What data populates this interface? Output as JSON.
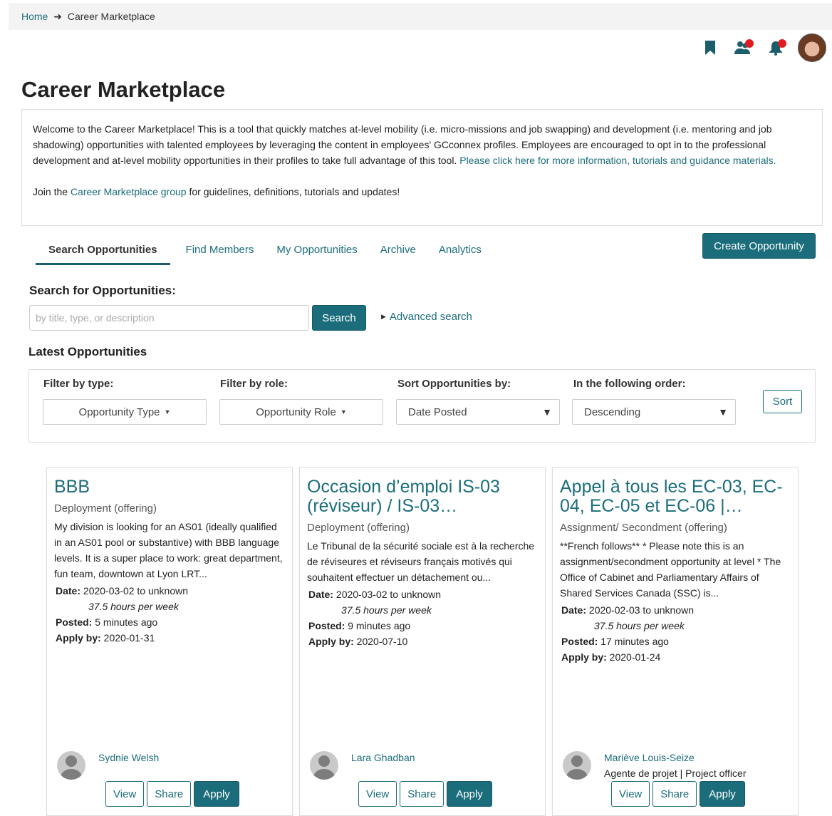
{
  "breadcrumb": {
    "home": "Home",
    "separator": "➜",
    "current": "Career Marketplace"
  },
  "header_icons": [
    "bookmark-icon",
    "colleagues-icon",
    "notifications-icon",
    "user-avatar"
  ],
  "page_title": "Career Marketplace",
  "welcome": {
    "text": "Welcome to the Career Marketplace! This is a tool that quickly matches at-level mobility (i.e. micro-missions and job swapping) and development (i.e. mentoring and job shadowing) opportunities with talented employees by leveraging the content in employees' GCconnex profiles. Employees are encouraged to opt in to the professional development and at-level mobility opportunities in their profiles to take full advantage of this tool.",
    "more_info_link": "Please click here for more information, tutorials and guidance materials.",
    "join_prefix": "Join the",
    "group_link": "Career Marketplace group",
    "join_suffix": "for guidelines, definitions, tutorials and updates!"
  },
  "tabs": [
    {
      "label": "Search Opportunities",
      "active": true
    },
    {
      "label": "Find Members",
      "active": false
    },
    {
      "label": "My Opportunities",
      "active": false
    },
    {
      "label": "Archive",
      "active": false
    },
    {
      "label": "Analytics",
      "active": false
    }
  ],
  "create_button": "Create Opportunity",
  "search": {
    "label": "Search for Opportunities:",
    "placeholder": "by title, type, or description",
    "value": "",
    "button": "Search",
    "advanced": "Advanced search"
  },
  "latest_label": "Latest Opportunities",
  "filters": {
    "type_label": "Filter by type:",
    "type_value": "Opportunity Type",
    "role_label": "Filter by role:",
    "role_value": "Opportunity Role",
    "sort_label": "Sort Opportunities by:",
    "sort_value": "Date Posted",
    "order_label": "In the following order:",
    "order_value": "Descending",
    "sort_button": "Sort"
  },
  "meta_labels": {
    "date": "Date:",
    "posted": "Posted:",
    "apply_by": "Apply by:"
  },
  "card_buttons": {
    "view": "View",
    "share": "Share",
    "apply": "Apply"
  },
  "cards": [
    {
      "title": "BBB",
      "type": "Deployment (offering)",
      "description": "My division is looking for an AS01 (ideally qualified in an AS01 pool or substantive) with BBB language levels. It is a super place to work: great department, fun team, downtown at Lyon LRT...",
      "date": "2020-03-02 to unknown",
      "hours": "37.5 hours per week",
      "posted": "5 minutes ago",
      "apply_by": "2020-01-31",
      "owner": "Sydnie Welsh",
      "owner_role": ""
    },
    {
      "title": "Occasion d’emploi IS-03 (réviseur) / IS-03…",
      "type": "Deployment (offering)",
      "description": "Le Tribunal de la sécurité sociale est à la recherche de réviseures et réviseurs français motivés qui souhaitent effectuer un détachement ou...",
      "date": "2020-03-02 to unknown",
      "hours": "37.5 hours per week",
      "posted": "9 minutes ago",
      "apply_by": "2020-07-10",
      "owner": "Lara Ghadban",
      "owner_role": ""
    },
    {
      "title": "Appel à tous les EC-03, EC-04, EC-05 et EC-06 |…",
      "type": "Assignment/ Secondment (offering)",
      "description": "**French follows**   * Please note this is an assignment/secondment opportunity at level *   The Office of Cabinet and Parliamentary Affairs of Shared Services Canada (SSC) is...",
      "date": "2020-02-03 to unknown",
      "hours": "37.5 hours per week",
      "posted": "17 minutes ago",
      "apply_by": "2020-01-24",
      "owner": "Mariève Louis-Seize",
      "owner_role": "Agente de projet | Project officer"
    }
  ],
  "colors": {
    "accent": "#1b6d7c",
    "notification": "#e11b22"
  }
}
